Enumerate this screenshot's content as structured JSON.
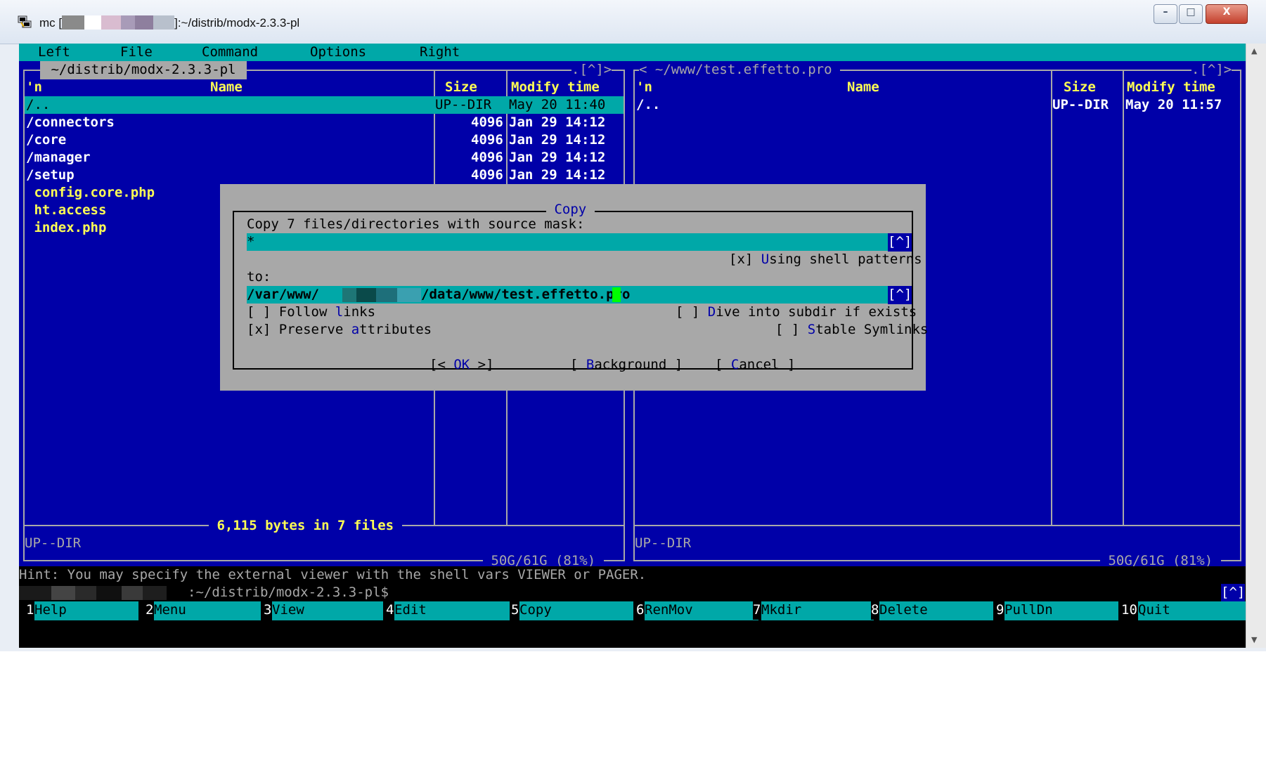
{
  "window": {
    "title_prefix": "mc [",
    "title_suffix": "]:~/distrib/modx-2.3.3-pl",
    "buttons": [
      "minimize",
      "maximize",
      "close"
    ],
    "close_glyph": "X"
  },
  "menu": [
    "Left",
    "File",
    "Command",
    "Options",
    "Right"
  ],
  "left_panel": {
    "path": " ~/distrib/modx-2.3.3-pl ",
    "corner": ".[^]>",
    "col_n": "'n",
    "col_name": "Name",
    "col_size": "Size",
    "col_time": "Modify time",
    "rows": [
      {
        "name": "/..",
        "size": "UP--DIR",
        "time": "May 20 11:40",
        "kind": "updir"
      },
      {
        "name": "/connectors",
        "size": "4096",
        "time": "Jan 29 14:12",
        "kind": "dir"
      },
      {
        "name": "/core",
        "size": "4096",
        "time": "Jan 29 14:12",
        "kind": "dir"
      },
      {
        "name": "/manager",
        "size": "4096",
        "time": "Jan 29 14:12",
        "kind": "dir"
      },
      {
        "name": "/setup",
        "size": "4096",
        "time": "Jan 29 14:12",
        "kind": "dir"
      },
      {
        "name": " config.core.php",
        "size": "",
        "time": "",
        "kind": "file"
      },
      {
        "name": " ht.access",
        "size": "",
        "time": "",
        "kind": "file"
      },
      {
        "name": " index.php",
        "size": "",
        "time": "",
        "kind": "file"
      }
    ],
    "summary": " 6,115 bytes in 7 files ",
    "status": "UP--DIR",
    "disk": " 50G/61G (81%) "
  },
  "right_panel": {
    "path": "< ~/www/test.effetto.pro ",
    "corner": ".[^]>",
    "col_n": "'n",
    "col_name": "Name",
    "col_size": "Size",
    "col_time": "Modify time",
    "rows": [
      {
        "name": "/..",
        "size": "UP--DIR",
        "time": "May 20 11:57",
        "kind": "updir"
      }
    ],
    "status": "UP--DIR",
    "disk": " 50G/61G (81%) "
  },
  "dialog": {
    "title": " Copy ",
    "source_label": "Copy 7 files/directories with source mask:",
    "source_value": "*",
    "history_btn": "[^]",
    "shell_patterns_box": "[x]",
    "shell_patterns_hot": "U",
    "shell_patterns_rest": "sing shell patterns",
    "to_label": "to:",
    "dest_prefix": "/var/www/",
    "dest_suffix": "/data/www/test.effetto.pro",
    "follow_links_pre": "[ ] Follow ",
    "follow_links_hot": "l",
    "follow_links_post": "inks",
    "dive_pre": "[ ] ",
    "dive_hot": "D",
    "dive_post": "ive into subdir if exists",
    "preserve_pre": "[x] Preserve ",
    "preserve_hot": "a",
    "preserve_post": "ttributes",
    "stable_pre": "[ ] ",
    "stable_hot": "S",
    "stable_post": "table Symlinks",
    "ok_pre": "[< ",
    "ok_label": "OK",
    "ok_post": " >]",
    "bg_pre": "[ ",
    "bg_hot": "B",
    "bg_post": "ackground ]",
    "cancel_pre": "[ ",
    "cancel_hot": "C",
    "cancel_post": "ancel ]"
  },
  "hint": "Hint: You may specify the external viewer with the shell vars VIEWER or PAGER.",
  "prompt": ":~/distrib/modx-2.3.3-pl$",
  "prompt_history_btn": "[^]",
  "fkeys": [
    {
      "num": "1",
      "label": "Help"
    },
    {
      "num": "2",
      "label": "Menu"
    },
    {
      "num": "3",
      "label": "View"
    },
    {
      "num": "4",
      "label": "Edit"
    },
    {
      "num": "5",
      "label": "Copy"
    },
    {
      "num": "6",
      "label": "RenMov"
    },
    {
      "num": "7",
      "label": "Mkdir"
    },
    {
      "num": "8",
      "label": "Delete"
    },
    {
      "num": "9",
      "label": "PullDn"
    },
    {
      "num": "10",
      "label": "Quit"
    }
  ],
  "colors": {
    "panel_bg": "#0000a8",
    "cyan": "#00a8a8",
    "dialog_bg": "#a8a8a8",
    "header": "#ffff54"
  }
}
